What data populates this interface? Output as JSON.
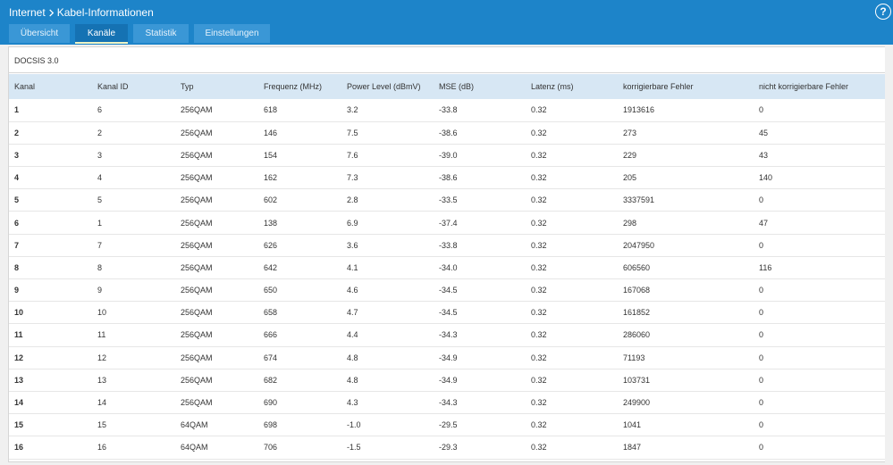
{
  "header": {
    "breadcrumb": [
      "Internet",
      "Kabel-Informationen"
    ],
    "help_label": "?"
  },
  "tabs": [
    {
      "label": "Übersicht",
      "active": false
    },
    {
      "label": "Kanäle",
      "active": true
    },
    {
      "label": "Statistik",
      "active": false
    },
    {
      "label": "Einstellungen",
      "active": false
    }
  ],
  "section": {
    "title": "DOCSIS 3.0"
  },
  "table": {
    "headers": [
      "Kanal",
      "Kanal ID",
      "Typ",
      "Frequenz (MHz)",
      "Power Level (dBmV)",
      "MSE (dB)",
      "Latenz (ms)",
      "korrigierbare Fehler",
      "nicht korrigierbare Fehler"
    ],
    "rows": [
      [
        "1",
        "6",
        "256QAM",
        "618",
        "3.2",
        "-33.8",
        "0.32",
        "1913616",
        "0"
      ],
      [
        "2",
        "2",
        "256QAM",
        "146",
        "7.5",
        "-38.6",
        "0.32",
        "273",
        "45"
      ],
      [
        "3",
        "3",
        "256QAM",
        "154",
        "7.6",
        "-39.0",
        "0.32",
        "229",
        "43"
      ],
      [
        "4",
        "4",
        "256QAM",
        "162",
        "7.3",
        "-38.6",
        "0.32",
        "205",
        "140"
      ],
      [
        "5",
        "5",
        "256QAM",
        "602",
        "2.8",
        "-33.5",
        "0.32",
        "3337591",
        "0"
      ],
      [
        "6",
        "1",
        "256QAM",
        "138",
        "6.9",
        "-37.4",
        "0.32",
        "298",
        "47"
      ],
      [
        "7",
        "7",
        "256QAM",
        "626",
        "3.6",
        "-33.8",
        "0.32",
        "2047950",
        "0"
      ],
      [
        "8",
        "8",
        "256QAM",
        "642",
        "4.1",
        "-34.0",
        "0.32",
        "606560",
        "116"
      ],
      [
        "9",
        "9",
        "256QAM",
        "650",
        "4.6",
        "-34.5",
        "0.32",
        "167068",
        "0"
      ],
      [
        "10",
        "10",
        "256QAM",
        "658",
        "4.7",
        "-34.5",
        "0.32",
        "161852",
        "0"
      ],
      [
        "11",
        "11",
        "256QAM",
        "666",
        "4.4",
        "-34.3",
        "0.32",
        "286060",
        "0"
      ],
      [
        "12",
        "12",
        "256QAM",
        "674",
        "4.8",
        "-34.9",
        "0.32",
        "71193",
        "0"
      ],
      [
        "13",
        "13",
        "256QAM",
        "682",
        "4.8",
        "-34.9",
        "0.32",
        "103731",
        "0"
      ],
      [
        "14",
        "14",
        "256QAM",
        "690",
        "4.3",
        "-34.3",
        "0.32",
        "249900",
        "0"
      ],
      [
        "15",
        "15",
        "64QAM",
        "698",
        "-1.0",
        "-29.5",
        "0.32",
        "1041",
        "0"
      ],
      [
        "16",
        "16",
        "64QAM",
        "706",
        "-1.5",
        "-29.3",
        "0.32",
        "1847",
        "0"
      ]
    ]
  },
  "colors": {
    "header_blue": "#1d84c9",
    "tab_bg": "#3a97d6",
    "tab_active_bg": "#1572b3",
    "tab_active_underline": "#f0f4c3",
    "table_header_bg": "#d7e7f4"
  },
  "icons": {
    "chevron": "chevron-right-icon",
    "help": "help-icon"
  }
}
